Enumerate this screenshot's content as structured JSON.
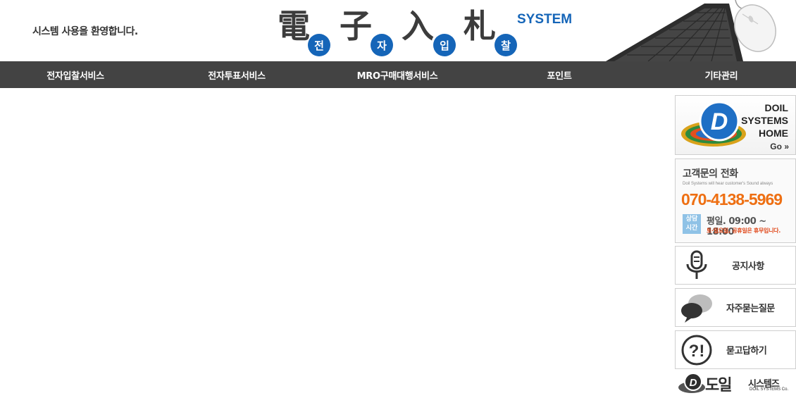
{
  "header": {
    "welcome": "시스템 사용을 환영합니다.",
    "logo": {
      "chars": [
        {
          "hanja": "電",
          "hangul": "전"
        },
        {
          "hanja": "子",
          "hangul": "자"
        },
        {
          "hanja": "入",
          "hangul": "입"
        },
        {
          "hanja": "札",
          "hangul": "찰"
        }
      ],
      "system_word": "SYSTEM"
    }
  },
  "nav": {
    "items": [
      {
        "label": "전자입찰서비스"
      },
      {
        "label": "전자투표서비스"
      },
      {
        "label": "MRO구매대행서비스"
      },
      {
        "label": "포인트"
      },
      {
        "label": "기타관리"
      }
    ]
  },
  "sidebar": {
    "home_banner": {
      "lines": [
        "DOIL",
        "SYSTEMS",
        "HOME"
      ],
      "go": "Go"
    },
    "tel_banner": {
      "title": "고객문의 전화",
      "subtitle": "Doil Systems will hear customer's Sound always",
      "number": "070-4138-5969",
      "badge_lines": [
        "상담",
        "시간"
      ],
      "hours": "평일. 09:00 ~ 18:00",
      "closed": "토·일요일, 공휴일은 휴무입니다."
    },
    "menu": [
      {
        "label": "공지사항",
        "icon": "microphone-icon"
      },
      {
        "label": "자주묻는질문",
        "icon": "speech-bubbles-icon"
      },
      {
        "label": "묻고답하기",
        "icon": "question-exclamation-icon"
      }
    ]
  },
  "footer": {
    "logo_word": "도일",
    "logo_kr": "시스템즈",
    "logo_en": "DOIL SYSTEMS Co."
  },
  "colors": {
    "nav_bg": "#434343",
    "accent_blue": "#1565b8",
    "accent_orange": "#ee6f12"
  }
}
